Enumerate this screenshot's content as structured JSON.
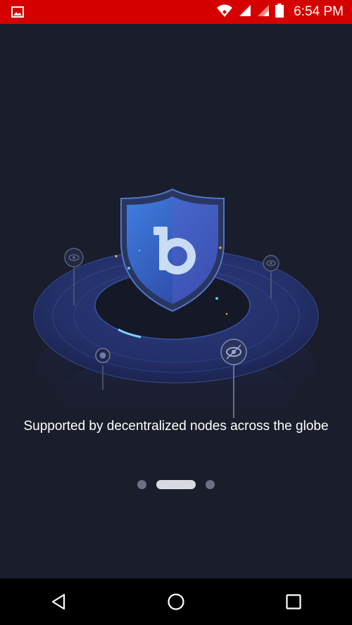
{
  "status_bar": {
    "time": "6:54 PM",
    "icons": [
      "gallery-icon",
      "wifi-icon",
      "signal-icon",
      "signal-icon",
      "battery-icon"
    ]
  },
  "onboarding": {
    "caption": "Supported by decentralized nodes across the globe",
    "pager": {
      "total": 3,
      "active_index": 1
    },
    "logo_icon": "shield-logo-icon",
    "colors": {
      "background": "#1a1d2b",
      "status_bar": "#d50000",
      "accent": "#3a6fd8"
    }
  },
  "nav_bar": {
    "icons": [
      "back-icon",
      "home-icon",
      "recents-icon"
    ]
  }
}
